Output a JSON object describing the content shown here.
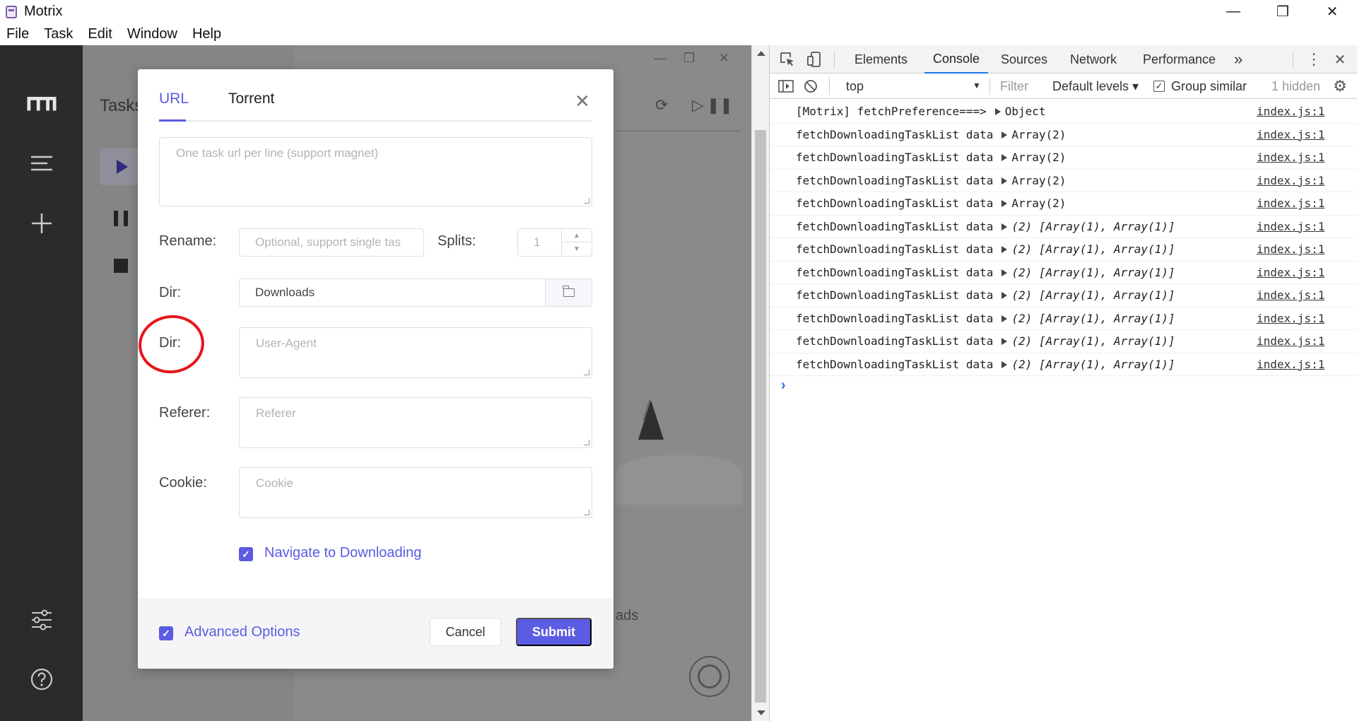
{
  "window": {
    "title": "Motrix",
    "controls": [
      "—",
      "❐",
      "✕"
    ]
  },
  "menu": [
    "File",
    "Task",
    "Edit",
    "Window",
    "Help"
  ],
  "app": {
    "tasks_title": "Tasks",
    "downloads_partial": "ads",
    "content_controls": [
      "⟳",
      "▷",
      "❚❚"
    ],
    "subwindow_controls": [
      "—",
      "❐",
      "✕"
    ],
    "sidebar_icons": [
      "m-logo-icon",
      "list-icon",
      "plus-icon",
      "sliders-icon",
      "help-icon"
    ]
  },
  "dialog": {
    "tabs": [
      "URL",
      "Torrent"
    ],
    "active_tab": "URL",
    "close": "✕",
    "url_placeholder": "One task url per line (support magnet)",
    "rename_label": "Rename:",
    "rename_placeholder": "Optional, support single tas",
    "splits_label": "Splits:",
    "splits_value": "1",
    "dir_label": "Dir:",
    "dir_value": "Downloads",
    "user_agent_label": "Dir:",
    "user_agent_placeholder": "User-Agent",
    "referer_label": "Referer:",
    "referer_placeholder": "Referer",
    "cookie_label": "Cookie:",
    "cookie_placeholder": "Cookie",
    "navigate_label": "Navigate to Downloading",
    "navigate_checked": true,
    "advanced_label": "Advanced Options",
    "advanced_checked": true,
    "cancel_label": "Cancel",
    "submit_label": "Submit"
  },
  "devtools": {
    "tabs": [
      "Elements",
      "Console",
      "Sources",
      "Network",
      "Performance"
    ],
    "active_tab": "Console",
    "more": "»",
    "context": "top",
    "filter_placeholder": "Filter",
    "levels": "Default levels ▾",
    "group_similar": "Group similar",
    "hidden_count": "1 hidden",
    "logs": [
      {
        "msg": "[Motrix] fetchPreference===>",
        "val": "Object",
        "italic": false,
        "src": "index.js:1"
      },
      {
        "msg": "fetchDownloadingTaskList data",
        "val": "Array(2)",
        "italic": false,
        "src": "index.js:1"
      },
      {
        "msg": "fetchDownloadingTaskList data",
        "val": "Array(2)",
        "italic": false,
        "src": "index.js:1"
      },
      {
        "msg": "fetchDownloadingTaskList data",
        "val": "Array(2)",
        "italic": false,
        "src": "index.js:1"
      },
      {
        "msg": "fetchDownloadingTaskList data",
        "val": "Array(2)",
        "italic": false,
        "src": "index.js:1"
      },
      {
        "msg": "fetchDownloadingTaskList data",
        "val": "(2) [Array(1), Array(1)]",
        "italic": true,
        "src": "index.js:1"
      },
      {
        "msg": "fetchDownloadingTaskList data",
        "val": "(2) [Array(1), Array(1)]",
        "italic": true,
        "src": "index.js:1"
      },
      {
        "msg": "fetchDownloadingTaskList data",
        "val": "(2) [Array(1), Array(1)]",
        "italic": true,
        "src": "index.js:1"
      },
      {
        "msg": "fetchDownloadingTaskList data",
        "val": "(2) [Array(1), Array(1)]",
        "italic": true,
        "src": "index.js:1"
      },
      {
        "msg": "fetchDownloadingTaskList data",
        "val": "(2) [Array(1), Array(1)]",
        "italic": true,
        "src": "index.js:1"
      },
      {
        "msg": "fetchDownloadingTaskList data",
        "val": "(2) [Array(1), Array(1)]",
        "italic": true,
        "src": "index.js:1"
      },
      {
        "msg": "fetchDownloadingTaskList data",
        "val": "(2) [Array(1), Array(1)]",
        "italic": true,
        "src": "index.js:1"
      }
    ],
    "prompt": "›"
  },
  "colors": {
    "accent": "#5b5ce2",
    "annotation": "#e8141b",
    "devtools_active": "#1a73e8"
  }
}
